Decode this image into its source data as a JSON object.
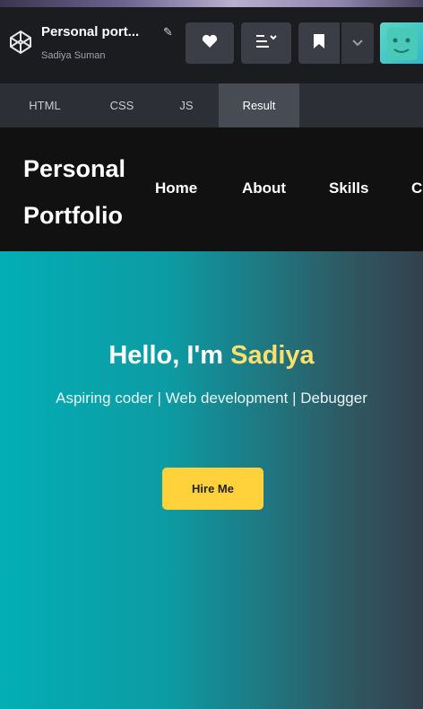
{
  "editor": {
    "project_title": "Personal port...",
    "author": "Sadiya Suman",
    "toolbar": {
      "like_icon": "heart-icon",
      "layout_icon": "layout-icon",
      "bookmark_icon": "bookmark-icon",
      "more_icon": "chevron-down-icon"
    },
    "tabs": [
      {
        "label": "HTML"
      },
      {
        "label": "CSS"
      },
      {
        "label": "JS"
      },
      {
        "label": "Result",
        "active": true
      }
    ]
  },
  "preview": {
    "brand": "Personal Portfolio",
    "nav": [
      "Home",
      "About",
      "Skills",
      "C"
    ],
    "hero": {
      "greeting": "Hello, I'm",
      "name": "Sadiya",
      "subtitle": "Aspiring coder | Web development | Debugger",
      "cta": "Hire Me"
    }
  },
  "colors": {
    "appbar_bg": "#1b1c20",
    "tabs_bg": "#2c2f35",
    "header_bg": "#111111",
    "hero_start": "#03aeb5",
    "hero_end": "#34414c",
    "accent_name": "#ffdf6e",
    "cta_bg": "#ffd23b"
  }
}
